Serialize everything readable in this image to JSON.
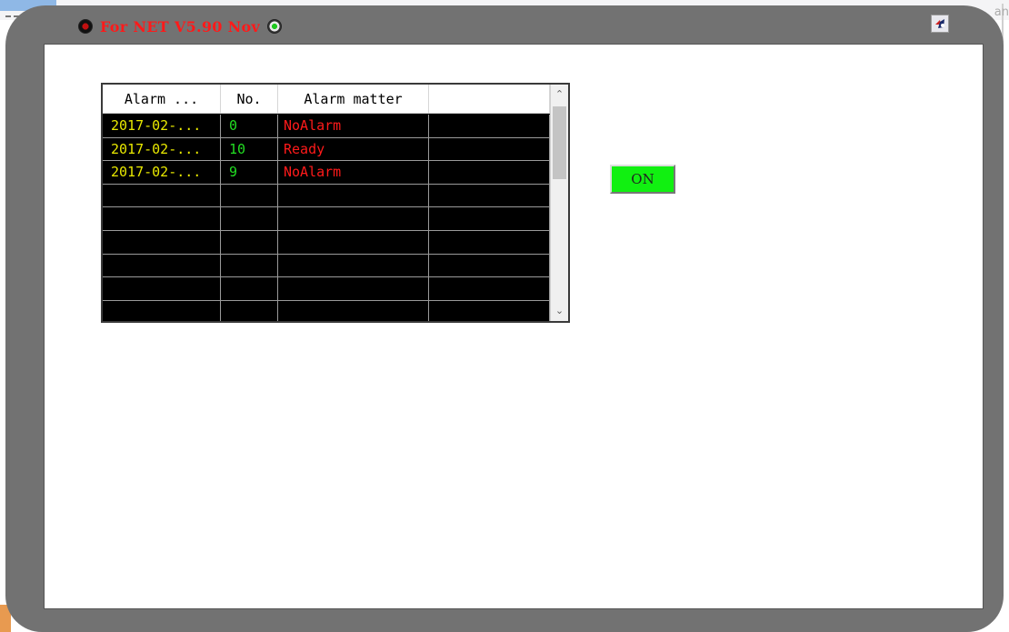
{
  "window": {
    "title": "For NET V5.90  Nov",
    "left_lamp_icon": "red-lamp-icon",
    "right_lamp_icon": "green-lamp-icon",
    "corner_icon": "settings-icon",
    "bg_right_text": "an"
  },
  "alarm_list": {
    "columns": [
      "Alarm ...",
      "No.",
      "Alarm matter",
      ""
    ],
    "rows": [
      {
        "time": "2017-02-...",
        "no": "0",
        "matter": "NoAlarm"
      },
      {
        "time": "2017-02-...",
        "no": "10",
        "matter": "Ready"
      },
      {
        "time": "2017-02-...",
        "no": "9",
        "matter": "NoAlarm"
      },
      {
        "time": "",
        "no": "",
        "matter": ""
      },
      {
        "time": "",
        "no": "",
        "matter": ""
      },
      {
        "time": "",
        "no": "",
        "matter": ""
      },
      {
        "time": "",
        "no": "",
        "matter": ""
      },
      {
        "time": "",
        "no": "",
        "matter": ""
      },
      {
        "time": "",
        "no": "",
        "matter": ""
      }
    ],
    "colors": {
      "time": "#e8e800",
      "no": "#22dd22",
      "matter": "#ff1a1a",
      "background": "#000000"
    }
  },
  "on_button": {
    "label": "ON",
    "color": "#11f011"
  },
  "frame": {
    "color": "#727272"
  }
}
